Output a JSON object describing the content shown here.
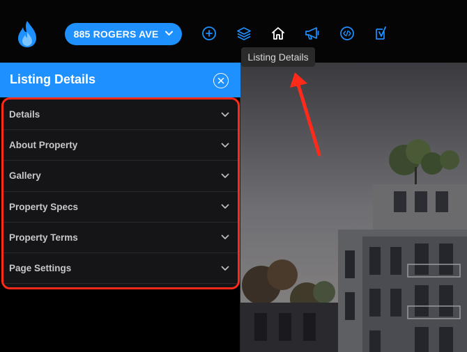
{
  "topbar": {
    "address_label": "885 ROGERS AVE",
    "icons": [
      "add-circle-icon",
      "layers-icon",
      "home-icon",
      "megaphone-icon",
      "code-icon",
      "yoast-icon"
    ],
    "tooltip": "Listing Details"
  },
  "panel": {
    "title": "Listing Details",
    "items": [
      {
        "label": "Details"
      },
      {
        "label": "About Property"
      },
      {
        "label": "Gallery"
      },
      {
        "label": "Property Specs"
      },
      {
        "label": "Property Terms"
      },
      {
        "label": "Page Settings"
      }
    ]
  },
  "colors": {
    "accent": "#1e90ff",
    "highlight": "#ff2a1a",
    "panel_bg": "#151517"
  }
}
